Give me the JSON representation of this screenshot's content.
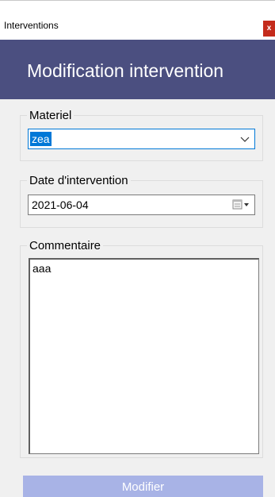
{
  "window": {
    "title": "Interventions",
    "close_label": "x"
  },
  "header": {
    "title": "Modification intervention"
  },
  "form": {
    "materiel": {
      "legend": "Materiel",
      "value": "zea"
    },
    "date": {
      "legend": "Date d'intervention",
      "value": "2021-06-04"
    },
    "comment": {
      "legend": "Commentaire",
      "value": "aaa"
    },
    "submit_label": "Modifier"
  },
  "icons": {
    "combo_arrow": "chevron-down-icon",
    "date_picker": "calendar-icon"
  },
  "colors": {
    "banner": "#4b4f80",
    "close": "#c42b1c",
    "selection": "#0078d7",
    "button": "#a8b3e6",
    "panel": "#f0f0f0"
  }
}
